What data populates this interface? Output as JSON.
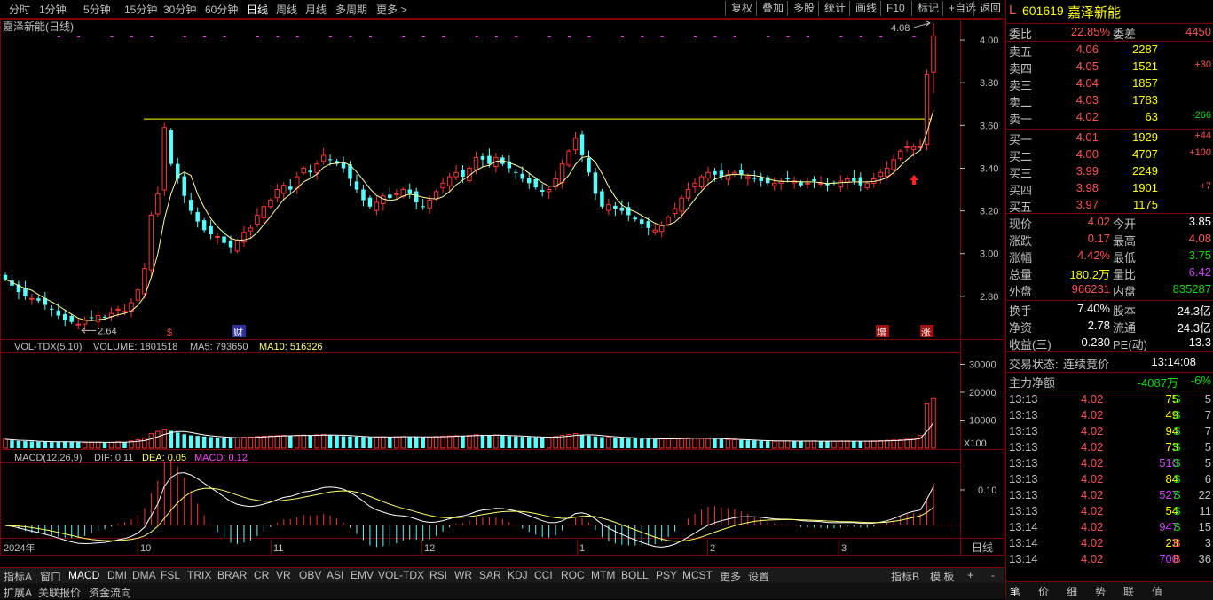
{
  "toolbar": {
    "periods": [
      "分时",
      "1分钟",
      "5分钟",
      "15分钟",
      "30分钟",
      "60分钟",
      "日线",
      "周线",
      "月线",
      "多周期",
      "更多 >"
    ],
    "selected_period": "日线",
    "tools": [
      "复权",
      "叠加",
      "多股",
      "统计",
      "画线",
      "F10",
      "标记",
      "+自选",
      "返回"
    ]
  },
  "chart": {
    "title": "嘉泽新能(日线)",
    "price_ticks": [
      "4.00",
      "3.80",
      "3.60",
      "3.40",
      "3.20",
      "3.00",
      "2.80"
    ],
    "high_label": "4.08",
    "low_label": "2.64",
    "events": [
      {
        "label": "$",
        "color": "#ff4040"
      },
      {
        "label": "财",
        "color": "#ffffff"
      },
      {
        "label": "增",
        "color": "#ffffff"
      },
      {
        "label": "涨",
        "color": "#ffffff"
      }
    ],
    "vol_title": "VOL-TDX(5,10)",
    "vol_volume": "VOLUME: 1801518",
    "vol_ma5": "MA5: 793650",
    "vol_ma10": "MA10: 516326",
    "vol_ticks": [
      "30000",
      "20000",
      "10000"
    ],
    "vol_unit": "X100",
    "macd_title": "MACD(12,26,9)",
    "macd_dif": "DIF: 0.11",
    "macd_dea": "DEA: 0.05",
    "macd_val": "MACD: 0.12",
    "macd_ticks": [
      "0.10"
    ],
    "x_labels": [
      "2024年",
      "10",
      "11",
      "12",
      "1",
      "2",
      "3"
    ],
    "period_label": "日线",
    "colors": {
      "up": "#ff3232",
      "down": "#54ffff",
      "ma": "#ffff99",
      "resistance": "#ffff00"
    }
  },
  "tabbar": {
    "tabs": [
      "指标A",
      "窗口",
      "MACD",
      "DMI",
      "DMA",
      "FSL",
      "TRIX",
      "BRAR",
      "CR",
      "VR",
      "OBV",
      "ASI",
      "EMV",
      "VOL-TDX",
      "RSI",
      "WR",
      "SAR",
      "KDJ",
      "CCI",
      "ROC",
      "MTM",
      "BOLL",
      "PSY",
      "MCST",
      "更多",
      "设置"
    ],
    "selected": "MACD",
    "right": [
      "指标B",
      "模 板",
      "+",
      "-"
    ]
  },
  "extbar": {
    "tabs": [
      "扩展A",
      "关联报价",
      "资金流向"
    ]
  },
  "panel": {
    "flag": "L",
    "code": "601619",
    "name": "嘉泽新能",
    "weibi_label": "委比",
    "weibi": "22.85%",
    "weicha_label": "委差",
    "weicha": "4450",
    "asks": [
      {
        "label": "卖五",
        "price": "4.06",
        "vol": "2287",
        "chg": ""
      },
      {
        "label": "卖四",
        "price": "4.05",
        "vol": "1521",
        "chg": "+30"
      },
      {
        "label": "卖三",
        "price": "4.04",
        "vol": "1857",
        "chg": ""
      },
      {
        "label": "卖二",
        "price": "4.03",
        "vol": "1783",
        "chg": ""
      },
      {
        "label": "卖一",
        "price": "4.02",
        "vol": "63",
        "chg": "-266"
      }
    ],
    "bids": [
      {
        "label": "买一",
        "price": "4.01",
        "vol": "1929",
        "chg": "+44"
      },
      {
        "label": "买二",
        "price": "4.00",
        "vol": "4707",
        "chg": "+100"
      },
      {
        "label": "买三",
        "price": "3.99",
        "vol": "2249",
        "chg": ""
      },
      {
        "label": "买四",
        "price": "3.98",
        "vol": "1901",
        "chg": "+7"
      },
      {
        "label": "买五",
        "price": "3.97",
        "vol": "1175",
        "chg": ""
      }
    ],
    "quote": [
      {
        "l1": "现价",
        "v1": "4.02",
        "c1": "red",
        "l2": "今开",
        "v2": "3.85",
        "c2": "white"
      },
      {
        "l1": "涨跌",
        "v1": "0.17",
        "c1": "red",
        "l2": "最高",
        "v2": "4.08",
        "c2": "red"
      },
      {
        "l1": "涨幅",
        "v1": "4.42%",
        "c1": "red",
        "l2": "最低",
        "v2": "3.75",
        "c2": "green"
      },
      {
        "l1": "总量",
        "v1": "180.2万",
        "c1": "yellow",
        "l2": "量比",
        "v2": "6.42",
        "c2": "purple"
      },
      {
        "l1": "外盘",
        "v1": "966231",
        "c1": "red",
        "l2": "内盘",
        "v2": "835287",
        "c2": "green"
      }
    ],
    "fund": [
      {
        "l1": "换手",
        "v1": "7.40%",
        "l2": "股本",
        "v2": "24.3亿"
      },
      {
        "l1": "净资",
        "v1": "2.78",
        "l2": "流通",
        "v2": "24.3亿"
      },
      {
        "l1": "收益(三)",
        "v1": "0.230",
        "l2": "PE(动)",
        "v2": "13.3"
      }
    ],
    "status_label": "交易状态:",
    "status": "连续竞价",
    "status_time": "13:14:08",
    "main_label": "主力净额",
    "main_value": "-4087万",
    "main_pct": "-6%",
    "ticks": [
      {
        "t": "13:13",
        "p": "4.02",
        "v": "75",
        "bs": "S",
        "n": "5",
        "vc": "yellow"
      },
      {
        "t": "13:13",
        "p": "4.02",
        "v": "49",
        "bs": "S",
        "n": "7",
        "vc": "yellow"
      },
      {
        "t": "13:13",
        "p": "4.02",
        "v": "94",
        "bs": "S",
        "n": "7",
        "vc": "yellow"
      },
      {
        "t": "13:13",
        "p": "4.02",
        "v": "73",
        "bs": "S",
        "n": "5",
        "vc": "yellow"
      },
      {
        "t": "13:13",
        "p": "4.02",
        "v": "510",
        "bs": "S",
        "n": "5",
        "vc": "purple"
      },
      {
        "t": "13:13",
        "p": "4.02",
        "v": "84",
        "bs": "S",
        "n": "6",
        "vc": "yellow"
      },
      {
        "t": "13:13",
        "p": "4.02",
        "v": "527",
        "bs": "S",
        "n": "22",
        "vc": "purple"
      },
      {
        "t": "13:13",
        "p": "4.02",
        "v": "54",
        "bs": "S",
        "n": "11",
        "vc": "yellow"
      },
      {
        "t": "13:14",
        "p": "4.02",
        "v": "947",
        "bs": "S",
        "n": "15",
        "vc": "purple"
      },
      {
        "t": "13:14",
        "p": "4.02",
        "v": "23",
        "bs": "B",
        "n": "3",
        "vc": "yellow"
      },
      {
        "t": "13:14",
        "p": "4.02",
        "v": "700",
        "bs": "B",
        "n": "36",
        "vc": "purple"
      }
    ],
    "bottom_tabs": [
      "笔",
      "价",
      "细",
      "势",
      "联",
      "值"
    ]
  },
  "chart_data": {
    "type": "candlestick",
    "title": "嘉泽新能(日线)",
    "xlabel": "",
    "ylabel": "",
    "ylim": [
      2.6,
      4.1
    ],
    "resistance": 3.63,
    "high": 4.08,
    "low": 2.64,
    "x_labels": [
      "2024年",
      "10",
      "11",
      "12",
      "1",
      "2",
      "3"
    ],
    "closes": [
      2.88,
      2.85,
      2.82,
      2.8,
      2.79,
      2.78,
      2.76,
      2.74,
      2.71,
      2.69,
      2.68,
      2.67,
      2.69,
      2.7,
      2.71,
      2.7,
      2.72,
      2.74,
      2.73,
      2.77,
      2.83,
      2.93,
      3.18,
      3.28,
      3.59,
      3.42,
      3.35,
      3.27,
      3.2,
      3.15,
      3.11,
      3.09,
      3.08,
      3.05,
      3.03,
      3.06,
      3.1,
      3.12,
      3.18,
      3.22,
      3.25,
      3.3,
      3.32,
      3.3,
      3.36,
      3.4,
      3.38,
      3.42,
      3.46,
      3.44,
      3.42,
      3.4,
      3.35,
      3.3,
      3.25,
      3.22,
      3.24,
      3.27,
      3.26,
      3.28,
      3.3,
      3.28,
      3.24,
      3.22,
      3.25,
      3.29,
      3.33,
      3.36,
      3.38,
      3.36,
      3.4,
      3.45,
      3.44,
      3.42,
      3.45,
      3.42,
      3.4,
      3.38,
      3.35,
      3.33,
      3.31,
      3.29,
      3.3,
      3.35,
      3.42,
      3.48,
      3.54,
      3.46,
      3.38,
      3.28,
      3.22,
      3.23,
      3.21,
      3.2,
      3.18,
      3.16,
      3.14,
      3.12,
      3.11,
      3.13,
      3.17,
      3.21,
      3.26,
      3.3,
      3.33,
      3.36,
      3.38,
      3.37,
      3.36,
      3.37,
      3.38,
      3.37,
      3.36,
      3.35,
      3.34,
      3.33,
      3.33,
      3.34,
      3.35,
      3.34,
      3.32,
      3.33,
      3.34,
      3.33,
      3.32,
      3.33,
      3.34,
      3.35,
      3.34,
      3.32,
      3.33,
      3.35,
      3.38,
      3.4,
      3.44,
      3.48,
      3.5,
      3.5,
      3.5,
      3.84,
      4.02
    ],
    "volume_k": [
      3200,
      2800,
      2600,
      2500,
      2400,
      2300,
      2300,
      2200,
      2300,
      2400,
      2200,
      2100,
      2000,
      2100,
      2200,
      2000,
      2100,
      2300,
      2200,
      2600,
      3000,
      3600,
      5200,
      6000,
      6800,
      6200,
      5600,
      5000,
      4600,
      4400,
      4200,
      4000,
      3800,
      3700,
      3600,
      3700,
      3900,
      4000,
      4200,
      4300,
      4400,
      4500,
      4600,
      4400,
      4600,
      4700,
      4500,
      4800,
      4900,
      4700,
      4500,
      4300,
      4200,
      4100,
      4000,
      3900,
      4000,
      4100,
      4000,
      4100,
      4200,
      4100,
      4000,
      3900,
      4000,
      4200,
      4300,
      4400,
      4500,
      4300,
      4600,
      4800,
      4700,
      4500,
      4700,
      4500,
      4300,
      4200,
      4100,
      4000,
      3900,
      3800,
      3900,
      4200,
      4600,
      4900,
      5200,
      4800,
      4500,
      4200,
      4000,
      3900,
      3800,
      3700,
      3600,
      3500,
      3400,
      3300,
      3200,
      3300,
      3400,
      3500,
      3600,
      3700,
      3600,
      3500,
      3400,
      3300,
      3200,
      3100,
      3000,
      2900,
      2800,
      2700,
      2600,
      2500,
      2500,
      2600,
      2600,
      2500,
      2500,
      2500,
      2600,
      2500,
      2400,
      2500,
      2600,
      2600,
      2500,
      2400,
      2500,
      2600,
      2700,
      2800,
      2900,
      3000,
      3200,
      3500,
      4500,
      16000,
      18015
    ]
  }
}
